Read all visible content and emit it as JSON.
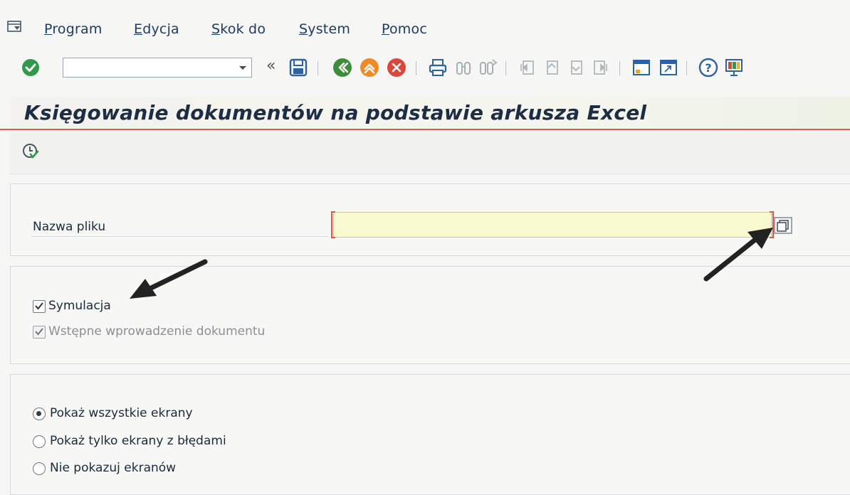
{
  "menu": {
    "items": [
      {
        "label": "Program"
      },
      {
        "label": "Edycja"
      },
      {
        "label": "Skok do"
      },
      {
        "label": "System"
      },
      {
        "label": "Pomoc"
      }
    ]
  },
  "toolbar": {
    "command_field_value": ""
  },
  "page": {
    "title": "Księgowanie dokumentów na podstawie arkusza Excel"
  },
  "file_group": {
    "label": "Nazwa pliku",
    "value": ""
  },
  "options": {
    "simulation": {
      "label": "Symulacja",
      "checked": true
    },
    "preliminary": {
      "label": "Wstępne wprowadzenie dokumentu",
      "checked": true,
      "enabled": false
    }
  },
  "screens": {
    "selected": "all",
    "options": [
      {
        "id": "all",
        "label": "Pokaż wszystkie ekrany"
      },
      {
        "id": "errors",
        "label": "Pokaż tylko ekrany z błędami"
      },
      {
        "id": "none",
        "label": "Nie pokazuj ekranów"
      }
    ]
  }
}
